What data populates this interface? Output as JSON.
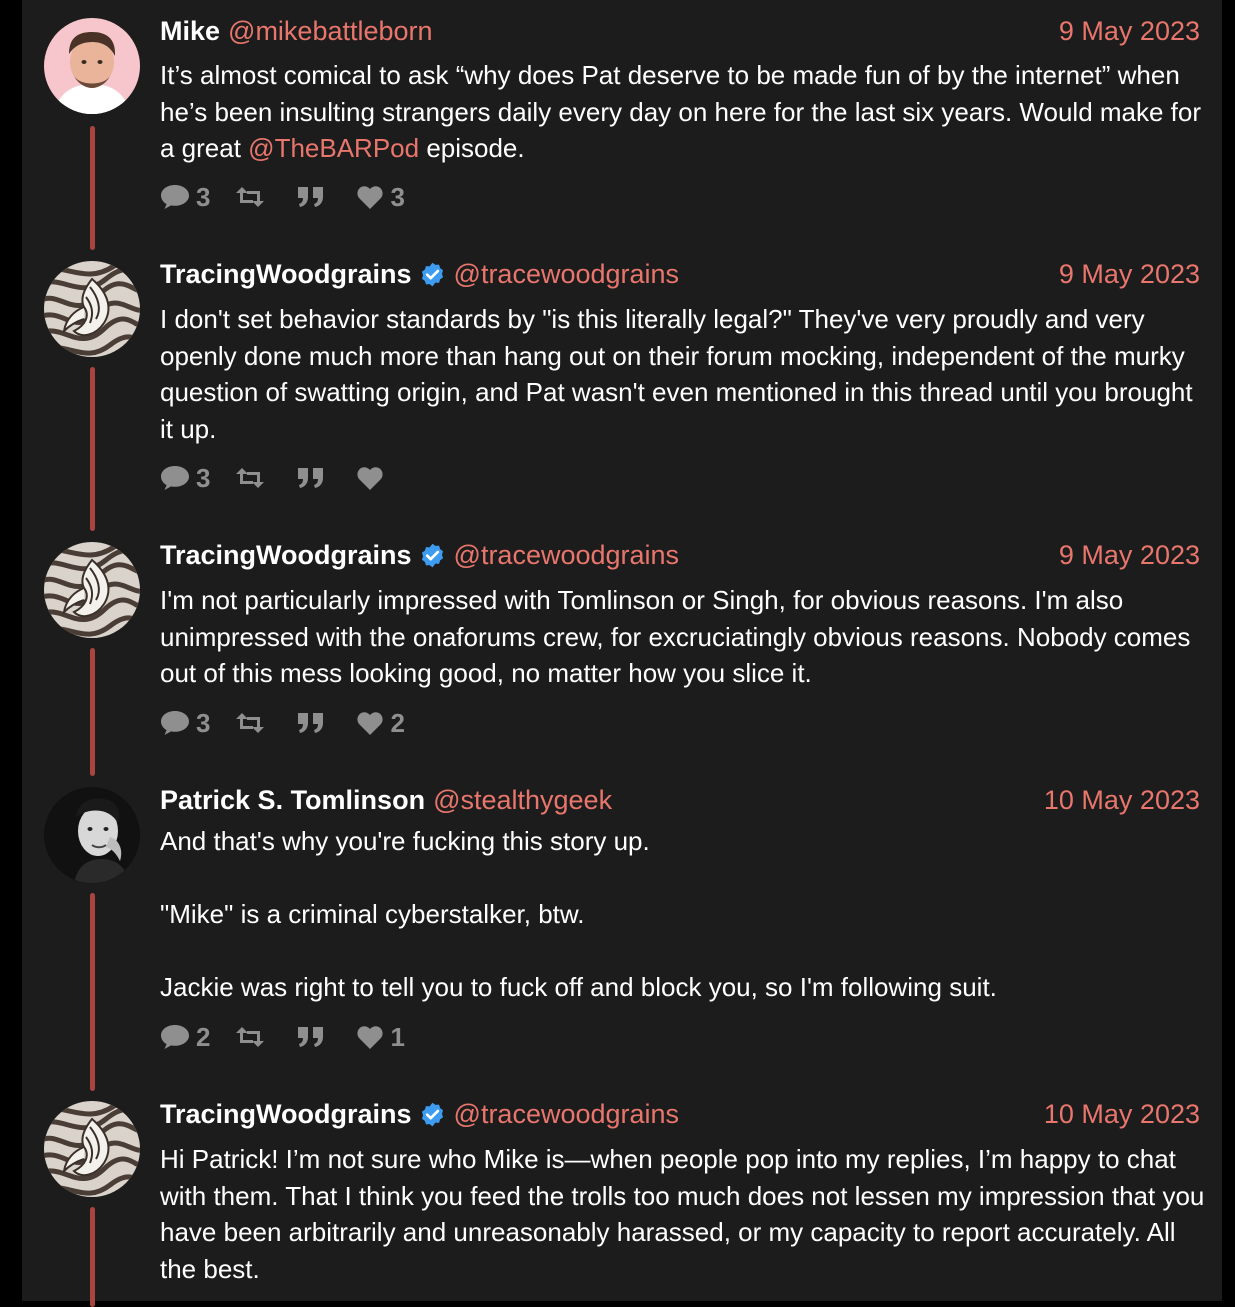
{
  "colors": {
    "accent": "#e8766c",
    "thread_line": "#a8453f",
    "background": "#1c1c1c",
    "verified": "#3d9bf0"
  },
  "tweets": [
    {
      "name": "Mike",
      "handle": "@mikebattleborn",
      "date": "9 May 2023",
      "verified": false,
      "avatar": "mike-avatar",
      "text_parts": [
        "It’s almost comical to ask “why does Pat deserve to be made fun of by the internet” when he’s been insulting strangers daily every day on here for the last six years. Would make for a great ",
        "@TheBARPod",
        " episode."
      ],
      "replies": "3",
      "retweets": "",
      "quotes": "",
      "likes": "3"
    },
    {
      "name": "TracingWoodgrains",
      "handle": "@tracewoodgrains",
      "date": "9 May 2023",
      "verified": true,
      "avatar": "woodgrain-avatar",
      "text": "I don't set behavior standards by \"is this literally legal?\" They've very proudly and very openly done much more than hang out on their forum mocking, independent of the murky question of swatting origin, and Pat wasn't even mentioned in this thread until you brought it up.",
      "replies": "3",
      "retweets": "",
      "quotes": "",
      "likes": ""
    },
    {
      "name": "TracingWoodgrains",
      "handle": "@tracewoodgrains",
      "date": "9 May 2023",
      "verified": true,
      "avatar": "woodgrain-avatar",
      "text": "I'm not particularly impressed with Tomlinson or Singh, for obvious reasons. I'm also unimpressed with the onaforums crew, for excruciatingly obvious reasons. Nobody comes out of this mess looking good, no matter how you slice it.",
      "replies": "3",
      "retweets": "",
      "quotes": "",
      "likes": "2"
    },
    {
      "name": "Patrick S. Tomlinson",
      "handle": "@stealthygeek",
      "date": "10 May 2023",
      "verified": false,
      "avatar": "patrick-avatar",
      "paragraphs": [
        "And that's why you're fucking this story up.",
        "\"Mike\" is a criminal cyberstalker, btw.",
        "Jackie was right to tell you to fuck off and block you, so I'm following suit."
      ],
      "replies": "2",
      "retweets": "",
      "quotes": "",
      "likes": "1"
    },
    {
      "name": "TracingWoodgrains",
      "handle": "@tracewoodgrains",
      "date": "10 May 2023",
      "verified": true,
      "avatar": "woodgrain-avatar",
      "text": "Hi Patrick! I’m not sure who Mike is—when people pop into my replies, I’m happy to chat with them. That I think you feed the trolls too much does not lessen my impression that you have been arbitrarily and unreasonably harassed, or my capacity to report accurately. All the best."
    }
  ]
}
